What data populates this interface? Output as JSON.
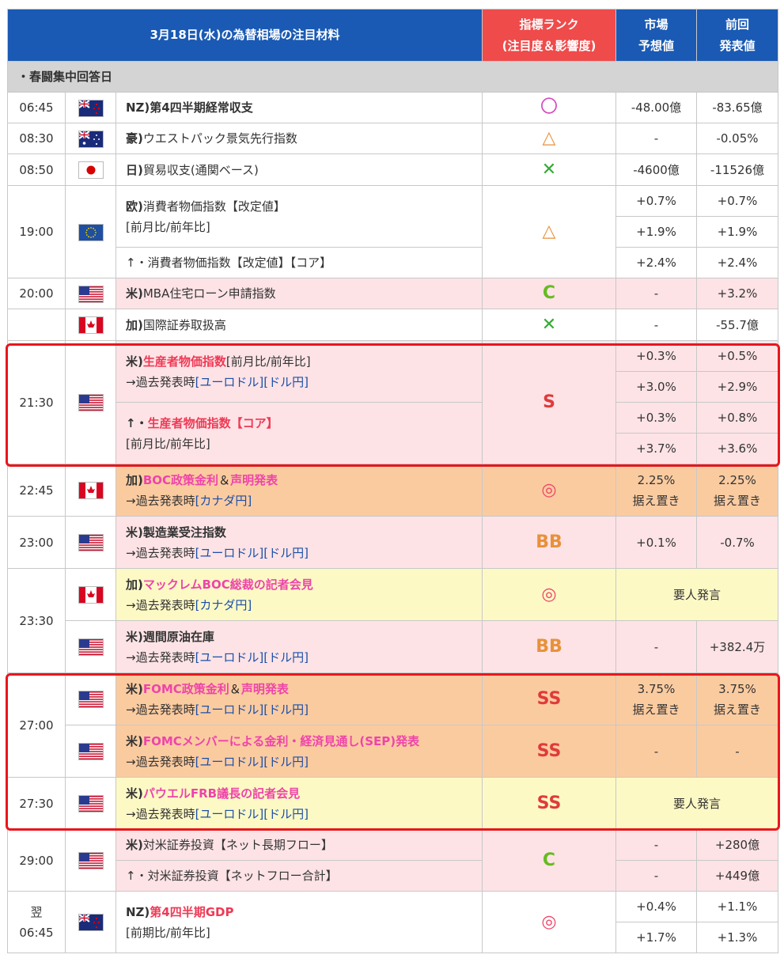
{
  "header": {
    "title": "3月18日(水)の為替相場の注目材料",
    "rank_label_1": "指標ランク",
    "rank_label_2": "(注目度＆影響度)",
    "forecast_1": "市場",
    "forecast_2": "予想値",
    "previous_1": "前回",
    "previous_2": "発表値"
  },
  "memo": "・春闘集中回答日",
  "colors": {
    "header": "#1a5ab4",
    "rank_header": "#ef4b4b",
    "pink": "#fde3e6",
    "orange": "#fbcba0",
    "yellow": "#fdf9c5",
    "highlight_box": "#e8161c"
  },
  "rows": {
    "r1": {
      "time": "06:45",
      "flag": "nz-flag",
      "prefix": "NZ)",
      "name": "第4四半期経常収支",
      "rank": "〇",
      "forecast": "-48.00億",
      "previous": "-83.65億"
    },
    "r2": {
      "time": "08:30",
      "flag": "au-flag",
      "prefix": "豪)",
      "name": "ウエストパック景気先行指数",
      "rank": "△",
      "forecast": "-",
      "previous": "-0.05%"
    },
    "r3": {
      "time": "08:50",
      "flag": "jp-flag",
      "prefix": "日)",
      "name": "貿易収支(通関ベース)",
      "rank": "✕",
      "forecast": "-4600億",
      "previous": "-11526億"
    },
    "r4": {
      "time": "19:00",
      "flag": "eu-flag",
      "prefix": "欧)",
      "name": "消費者物価指数【改定値】",
      "sub": "[前月比/前年比]",
      "name2": "↑・消費者物価指数【改定値】【コア】",
      "rank": "△",
      "f1": "+0.7%",
      "p1": "+0.7%",
      "f2": "+1.9%",
      "p2": "+1.9%",
      "f3": "+2.4%",
      "p3": "+2.4%"
    },
    "r5": {
      "time": "20:00",
      "flag": "us-flag",
      "prefix": "米)",
      "name": "MBA住宅ローン申請指数",
      "rank": "C",
      "forecast": "-",
      "previous": "+3.2%"
    },
    "r6": {
      "flag": "ca-flag",
      "prefix": "加)",
      "name": "国際証券取扱高",
      "rank": "✕",
      "forecast": "-",
      "previous": "-55.7億"
    },
    "r7": {
      "time": "21:30",
      "flag": "us-flag",
      "prefix": "米)",
      "name": "生産者物価指数",
      "name_tail": "[前月比/前年比]",
      "past_label": "→過去発表時",
      "link1": "[ユーロドル]",
      "link2": "[ドル円]",
      "prefix2": "↑・",
      "name2": "生産者物価指数",
      "name2_tail": "【コア】",
      "sub2": "[前月比/前年比]",
      "rank": "S",
      "f1": "+0.3%",
      "p1": "+0.5%",
      "f2": "+3.0%",
      "p2": "+2.9%",
      "f3": "+0.3%",
      "p3": "+0.8%",
      "f4": "+3.7%",
      "p4": "+3.6%"
    },
    "r8": {
      "time": "22:45",
      "flag": "ca-flag",
      "prefix": "加)",
      "name": "BOC政策金利",
      "amp": "＆",
      "name_b": "声明発表",
      "past_label": "→過去発表時",
      "link1": "[カナダ円]",
      "rank": "◎",
      "forecast": "2.25%",
      "forecast_sub": "据え置き",
      "previous": "2.25%",
      "previous_sub": "据え置き"
    },
    "r9": {
      "time": "23:00",
      "flag": "us-flag",
      "prefix": "米)",
      "name": "製造業受注指数",
      "past_label": "→過去発表時",
      "link1": "[ユーロドル]",
      "link2": "[ドル円]",
      "rank": "BB",
      "forecast": "+0.1%",
      "previous": "-0.7%"
    },
    "r10": {
      "time": "23:30",
      "flag": "ca-flag",
      "prefix": "加)",
      "name": "マックレムBOC総裁の記者会見",
      "past_label": "→過去発表時",
      "link1": "[カナダ円]",
      "rank": "◎",
      "merged": "要人発言"
    },
    "r11": {
      "flag": "us-flag",
      "prefix": "米)",
      "name": "週間原油在庫",
      "past_label": "→過去発表時",
      "link1": "[ユーロドル]",
      "link2": "[ドル円]",
      "rank": "BB",
      "forecast": "-",
      "previous": "+382.4万"
    },
    "r12": {
      "time": "27:00",
      "flag": "us-flag",
      "prefix": "米)",
      "name": "FOMC政策金利",
      "amp": "＆",
      "name_b": "声明発表",
      "past_label": "→過去発表時",
      "link1": "[ユーロドル]",
      "link2": "[ドル円]",
      "rank": "SS",
      "forecast": "3.75%",
      "forecast_sub": "据え置き",
      "previous": "3.75%",
      "previous_sub": "据え置き"
    },
    "r13": {
      "flag": "us-flag",
      "prefix": "米)",
      "name": "FOMCメンバーによる金利・経済見通し(SEP)発表",
      "past_label": "→過去発表時",
      "link1": "[ユーロドル]",
      "link2": "[ドル円]",
      "rank": "SS",
      "forecast": "-",
      "previous": "-"
    },
    "r14": {
      "time": "27:30",
      "flag": "us-flag",
      "prefix": "米)",
      "name": "パウエルFRB議長の記者会見",
      "past_label": "→過去発表時",
      "link1": "[ユーロドル]",
      "link2": "[ドル円]",
      "rank": "SS",
      "merged": "要人発言"
    },
    "r15": {
      "time": "29:00",
      "flag": "us-flag",
      "prefix": "米)",
      "name": "対米証券投資【ネット長期フロー】",
      "name2": "↑・対米証券投資【ネットフロー合計】",
      "rank": "C",
      "f1": "-",
      "p1": "+280億",
      "f2": "-",
      "p2": "+449億"
    },
    "r16": {
      "time_1": "翌",
      "time_2": "06:45",
      "flag": "nz-flag",
      "prefix": "NZ)",
      "name": "第4四半期GDP",
      "sub": "[前期比/前年比]",
      "rank": "◎",
      "f1": "+0.4%",
      "p1": "+1.1%",
      "f2": "+1.7%",
      "p2": "+1.3%"
    }
  }
}
